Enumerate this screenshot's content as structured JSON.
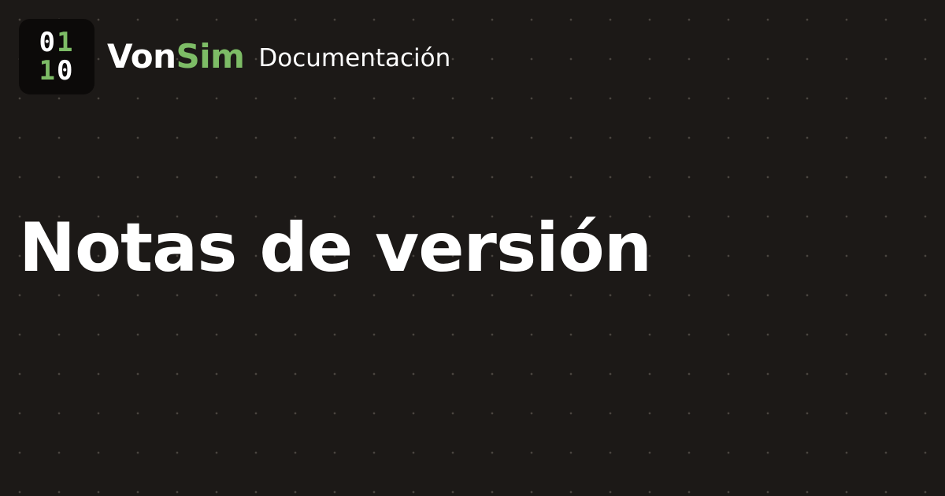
{
  "brand": {
    "logo": {
      "row1": [
        "0",
        "1"
      ],
      "row2": [
        "1",
        "0"
      ],
      "colors": {
        "white_bits": "#ffffff",
        "green_bits": "#7dbc66",
        "tile": "#0c0a09"
      }
    },
    "name_part1": "Von",
    "name_part2": "Sim",
    "section": "Documentación"
  },
  "page": {
    "title": "Notas de versión"
  },
  "theme": {
    "background": "#1c1917",
    "dot_color": "#4a4540",
    "accent": "#7dbc66",
    "text": "#ffffff"
  }
}
